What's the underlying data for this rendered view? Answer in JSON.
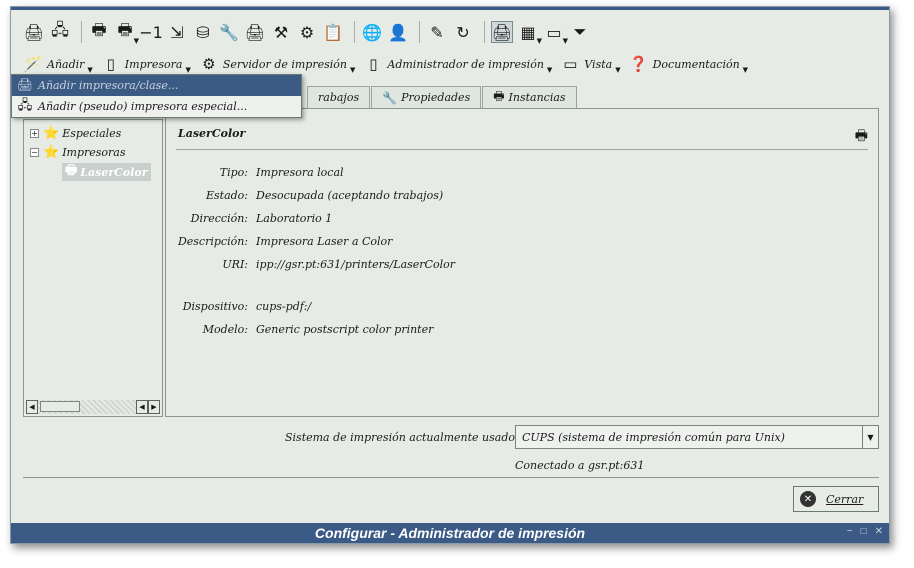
{
  "window": {
    "title": "Configurar - Administrador de impresión"
  },
  "toolbar": {
    "icons": [
      "printer-add-icon",
      "printer-class-icon",
      "printer-manage-icon",
      "printer-dropdown-icon",
      "minus-one-icon",
      "step-icon",
      "cylinder-icon",
      "wrench-icon",
      "printer-test-icon",
      "tools-icon",
      "gear-doc-icon",
      "clipboard-icon",
      "globe-icon",
      "user-print-icon",
      "image-edit-icon",
      "refresh-icon",
      "printer-view-icon",
      "grid-view-icon",
      "panel-view-icon",
      "filter-icon"
    ]
  },
  "menubar": {
    "items": [
      {
        "label": "Añadir",
        "icon": "magic-wand-icon"
      },
      {
        "label": "Impresora",
        "icon": "page-icon"
      },
      {
        "label": "Servidor de impresión",
        "icon": "gear-globe-icon"
      },
      {
        "label": "Administrador de impresión",
        "icon": "page-icon"
      },
      {
        "label": "Vista",
        "icon": "window-icon"
      },
      {
        "label": "Documentación",
        "icon": "help-icon"
      }
    ]
  },
  "popup": {
    "items": [
      {
        "label": "Añadir impresora/clase..."
      },
      {
        "label": "Añadir (pseudo) impresora especial..."
      }
    ]
  },
  "tabs": [
    {
      "label": "rabajos"
    },
    {
      "label": "Propiedades"
    },
    {
      "label": "Instancias"
    }
  ],
  "tree": {
    "items": [
      {
        "label": "Especiales"
      },
      {
        "label": "Impresoras"
      },
      {
        "label": "LaserColor"
      }
    ]
  },
  "details": {
    "title": "LaserColor",
    "rows": [
      {
        "label": "Tipo:",
        "value": "Impresora local"
      },
      {
        "label": "Estado:",
        "value": "Desocupada (aceptando trabajos)"
      },
      {
        "label": "Dirección:",
        "value": "Laboratorio 1"
      },
      {
        "label": "Descripción:",
        "value": "Impresora Laser a Color"
      },
      {
        "label": "URI:",
        "value": "ipp://gsr.pt:631/printers/LaserColor"
      },
      {
        "label": "Dispositivo:",
        "value": "cups-pdf:/"
      },
      {
        "label": "Modelo:",
        "value": "Generic postscript color printer"
      }
    ]
  },
  "bottom": {
    "system_label": "Sistema de impresión actualmente usado:",
    "system_value": "CUPS (sistema de impresión común para Unix)",
    "connected": "Conectado a gsr.pt:631",
    "close_label": "Cerrar"
  },
  "colors": {
    "titlebar": "#3b5a86",
    "window_bg": "#e6ebe6",
    "selection": "#3c5b84"
  }
}
